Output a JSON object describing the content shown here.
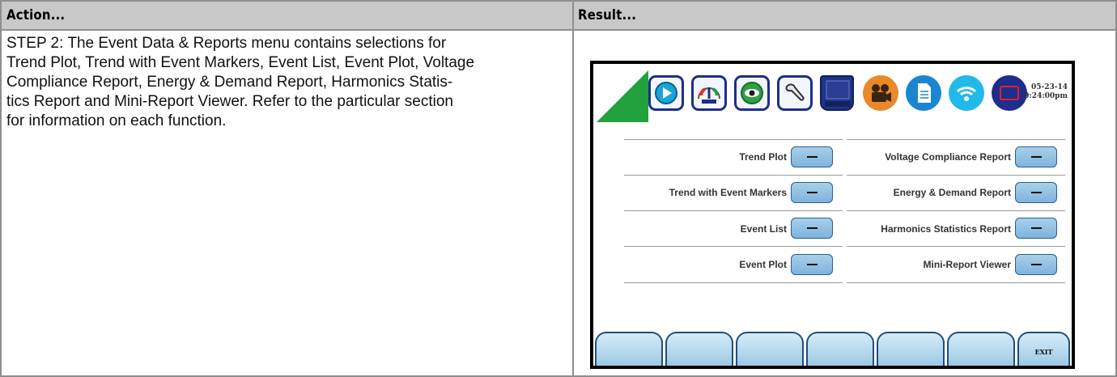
{
  "table": {
    "header_action": "Action...",
    "header_result": "Result...",
    "action_lines": [
      "STEP 2: The Event Data & Reports menu contains selections for",
      "Trend Plot, Trend with Event Markers, Event List, Event Plot, Voltage",
      "Compliance Report, Energy & Demand Report, Harmonics Statis-",
      "tics Report and Mini-Report Viewer. Refer to the particular section",
      "for information on each function."
    ]
  },
  "device": {
    "date": "05-23-14",
    "time": "9:24:00pm",
    "toolbar_icons": [
      "play-icon",
      "meter-gauge-icon",
      "eye-icon",
      "wrench-icon",
      "monitor-book-icon",
      "camcorder-icon",
      "document-icon",
      "wireless-icon",
      "screen-icon"
    ],
    "colors": {
      "accent_green": "#21a23d",
      "icon_navy": "#1c2f8a",
      "button_blue": "#8fc0e3"
    },
    "menu_left": [
      {
        "label": "Trend Plot",
        "button": "—"
      },
      {
        "label": "Trend with Event Markers",
        "button": "—"
      },
      {
        "label": "Event List",
        "button": "—"
      },
      {
        "label": "Event Plot",
        "button": "—"
      }
    ],
    "menu_right": [
      {
        "label": "Voltage Compliance Report",
        "button": "—"
      },
      {
        "label": "Energy & Demand Report",
        "button": "—"
      },
      {
        "label": "Harmonics Statistics Report",
        "button": "—"
      },
      {
        "label": "Mini-Report Viewer",
        "button": "—"
      }
    ],
    "function_keys": [
      "",
      "",
      "",
      "",
      "",
      "",
      "EXIT"
    ]
  }
}
